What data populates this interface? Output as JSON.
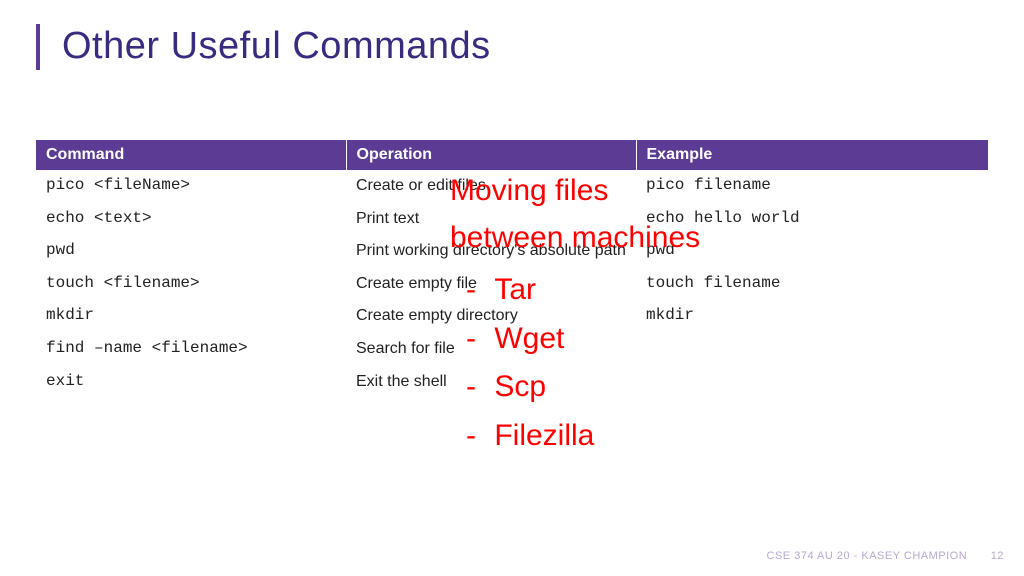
{
  "title": "Other Useful Commands",
  "table": {
    "headers": [
      "Command",
      "Operation",
      "Example"
    ],
    "rows": [
      {
        "cmd": "pico <fileName>",
        "op": "Create or edit files",
        "ex": "pico filename"
      },
      {
        "cmd": "echo <text>",
        "op": "Print text",
        "ex": "echo hello world"
      },
      {
        "cmd": "pwd",
        "op": "Print working directory's absolute path",
        "ex": "pwd"
      },
      {
        "cmd": "touch <filename>",
        "op": "Create empty file",
        "ex": "touch filename"
      },
      {
        "cmd": "mkdir",
        "op": "Create empty directory",
        "ex": "mkdir"
      },
      {
        "cmd": "find –name <filename>",
        "op": "Search for file",
        "ex": ""
      },
      {
        "cmd": "exit",
        "op": "Exit the shell",
        "ex": ""
      }
    ]
  },
  "overlay": {
    "heading_l1": "Moving files",
    "heading_l2": "between machines",
    "items": [
      "Tar",
      "Wget",
      "Scp",
      "Filezilla"
    ]
  },
  "footer": {
    "course": "CSE 374 AU 20 - KASEY CHAMPION",
    "page": "12"
  }
}
